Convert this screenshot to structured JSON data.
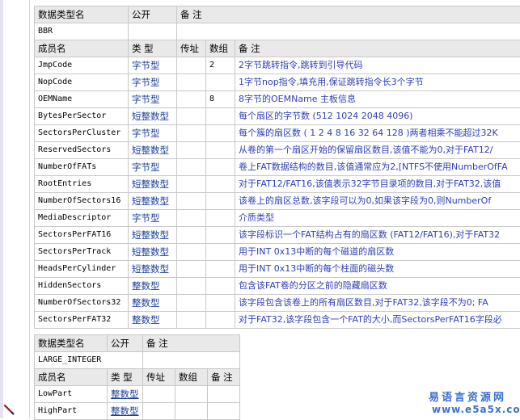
{
  "t1": {
    "header": {
      "name": "数据类型名",
      "public": "公开",
      "remark": "备 注"
    },
    "type_name": "BBR",
    "cols": {
      "name": "成员名",
      "type": "类 型",
      "ref": "传址",
      "array": "数组",
      "remark": "备 注"
    },
    "rows": [
      {
        "name": "JmpCode",
        "type": "字节型",
        "array": "2",
        "remark": "2字节跳转指令,跳转到引导代码"
      },
      {
        "name": "NopCode",
        "type": "字节型",
        "array": "",
        "remark": "1字节nop指令,填充用,保证跳转指令长3个字节"
      },
      {
        "name": "OEMName",
        "type": "字节型",
        "array": "8",
        "remark": "8字节的OEMName 主板信息"
      },
      {
        "name": "BytesPerSector",
        "type": "短整数型",
        "array": "",
        "remark": "每个扇区的字节数 (512 1024 2048 4096)"
      },
      {
        "name": "SectorsPerCluster",
        "type": "字节型",
        "array": "",
        "remark": "每个簇的扇区数 ( 1 2 4 8 16 32 64 128 )两者相乘不能超过32K"
      },
      {
        "name": "ReservedSectors",
        "type": "短整数型",
        "array": "",
        "remark": "从卷的第一个扇区开始的保留扇区数目,该值不能为0,对于FAT12/"
      },
      {
        "name": "NumberOfFATs",
        "type": "字节型",
        "array": "",
        "remark": "卷上FAT数据结构的数目,该值通常应为2,[NTFS不使用NumberOfFA"
      },
      {
        "name": "RootEntries",
        "type": "短整数型",
        "array": "",
        "remark": "对于FAT12/FAT16,该值表示32字节目录项的数目,对于FAT32,该值"
      },
      {
        "name": "NumberOfSectors16",
        "type": "短整数型",
        "array": "",
        "remark": "该卷上的扇区总数,该字段可以为0,如果该字段为0,则NumberOf"
      },
      {
        "name": "MediaDescriptor",
        "type": "字节型",
        "array": "",
        "remark": "介质类型"
      },
      {
        "name": "SectorsPerFAT16",
        "type": "短整数型",
        "array": "",
        "remark": "该字段标识一个FAT结构占有的扇区数 (FAT12/FAT16),对于FAT32"
      },
      {
        "name": "SectorsPerTrack",
        "type": "短整数型",
        "array": "",
        "remark": "用于INT 0x13中断的每个磁道的扇区数"
      },
      {
        "name": "HeadsPerCylinder",
        "type": "短整数型",
        "array": "",
        "remark": "用于INT 0x13中断的每个柱面的磁头数"
      },
      {
        "name": "HiddenSectors",
        "type": "整数型",
        "array": "",
        "remark": "包含该FAT卷的分区之前的隐藏扇区数"
      },
      {
        "name": "NumberOfSectors32",
        "type": "整数型",
        "array": "",
        "remark": "该字段包含该卷上的所有扇区数目,对于FAT32,该字段不为0; FA"
      },
      {
        "name": "SectorsPerFAT32",
        "type": "整数型",
        "array": "",
        "remark": "对于FAT32,该字段包含一个FAT的大小,而SectorsPerFAT16字段必"
      }
    ]
  },
  "t2": {
    "header": {
      "name": "数据类型名",
      "public": "公开",
      "remark": "备 注"
    },
    "type_name": "LARGE_INTEGER",
    "cols": {
      "name": "成员名",
      "type": "类 型",
      "ref": "传址",
      "array": "数组",
      "remark": "备 注"
    },
    "rows": [
      {
        "name": "LowPart",
        "type": "整数型",
        "array": "",
        "remark": ""
      },
      {
        "name": "HighPart",
        "type": "整数型",
        "array": "",
        "remark": ""
      }
    ]
  },
  "watermark": {
    "cn": "易语言资源网",
    "url": "www.e5a5x.com"
  },
  "icons": {
    "pencil": "pencil-icon"
  },
  "colors": {
    "type_text": "#1c3f9c",
    "remark_text": "#3040b8",
    "header_bg": "#e9e9e9",
    "grid": "#c8c8c8",
    "watermark": "#3d6fd0"
  }
}
